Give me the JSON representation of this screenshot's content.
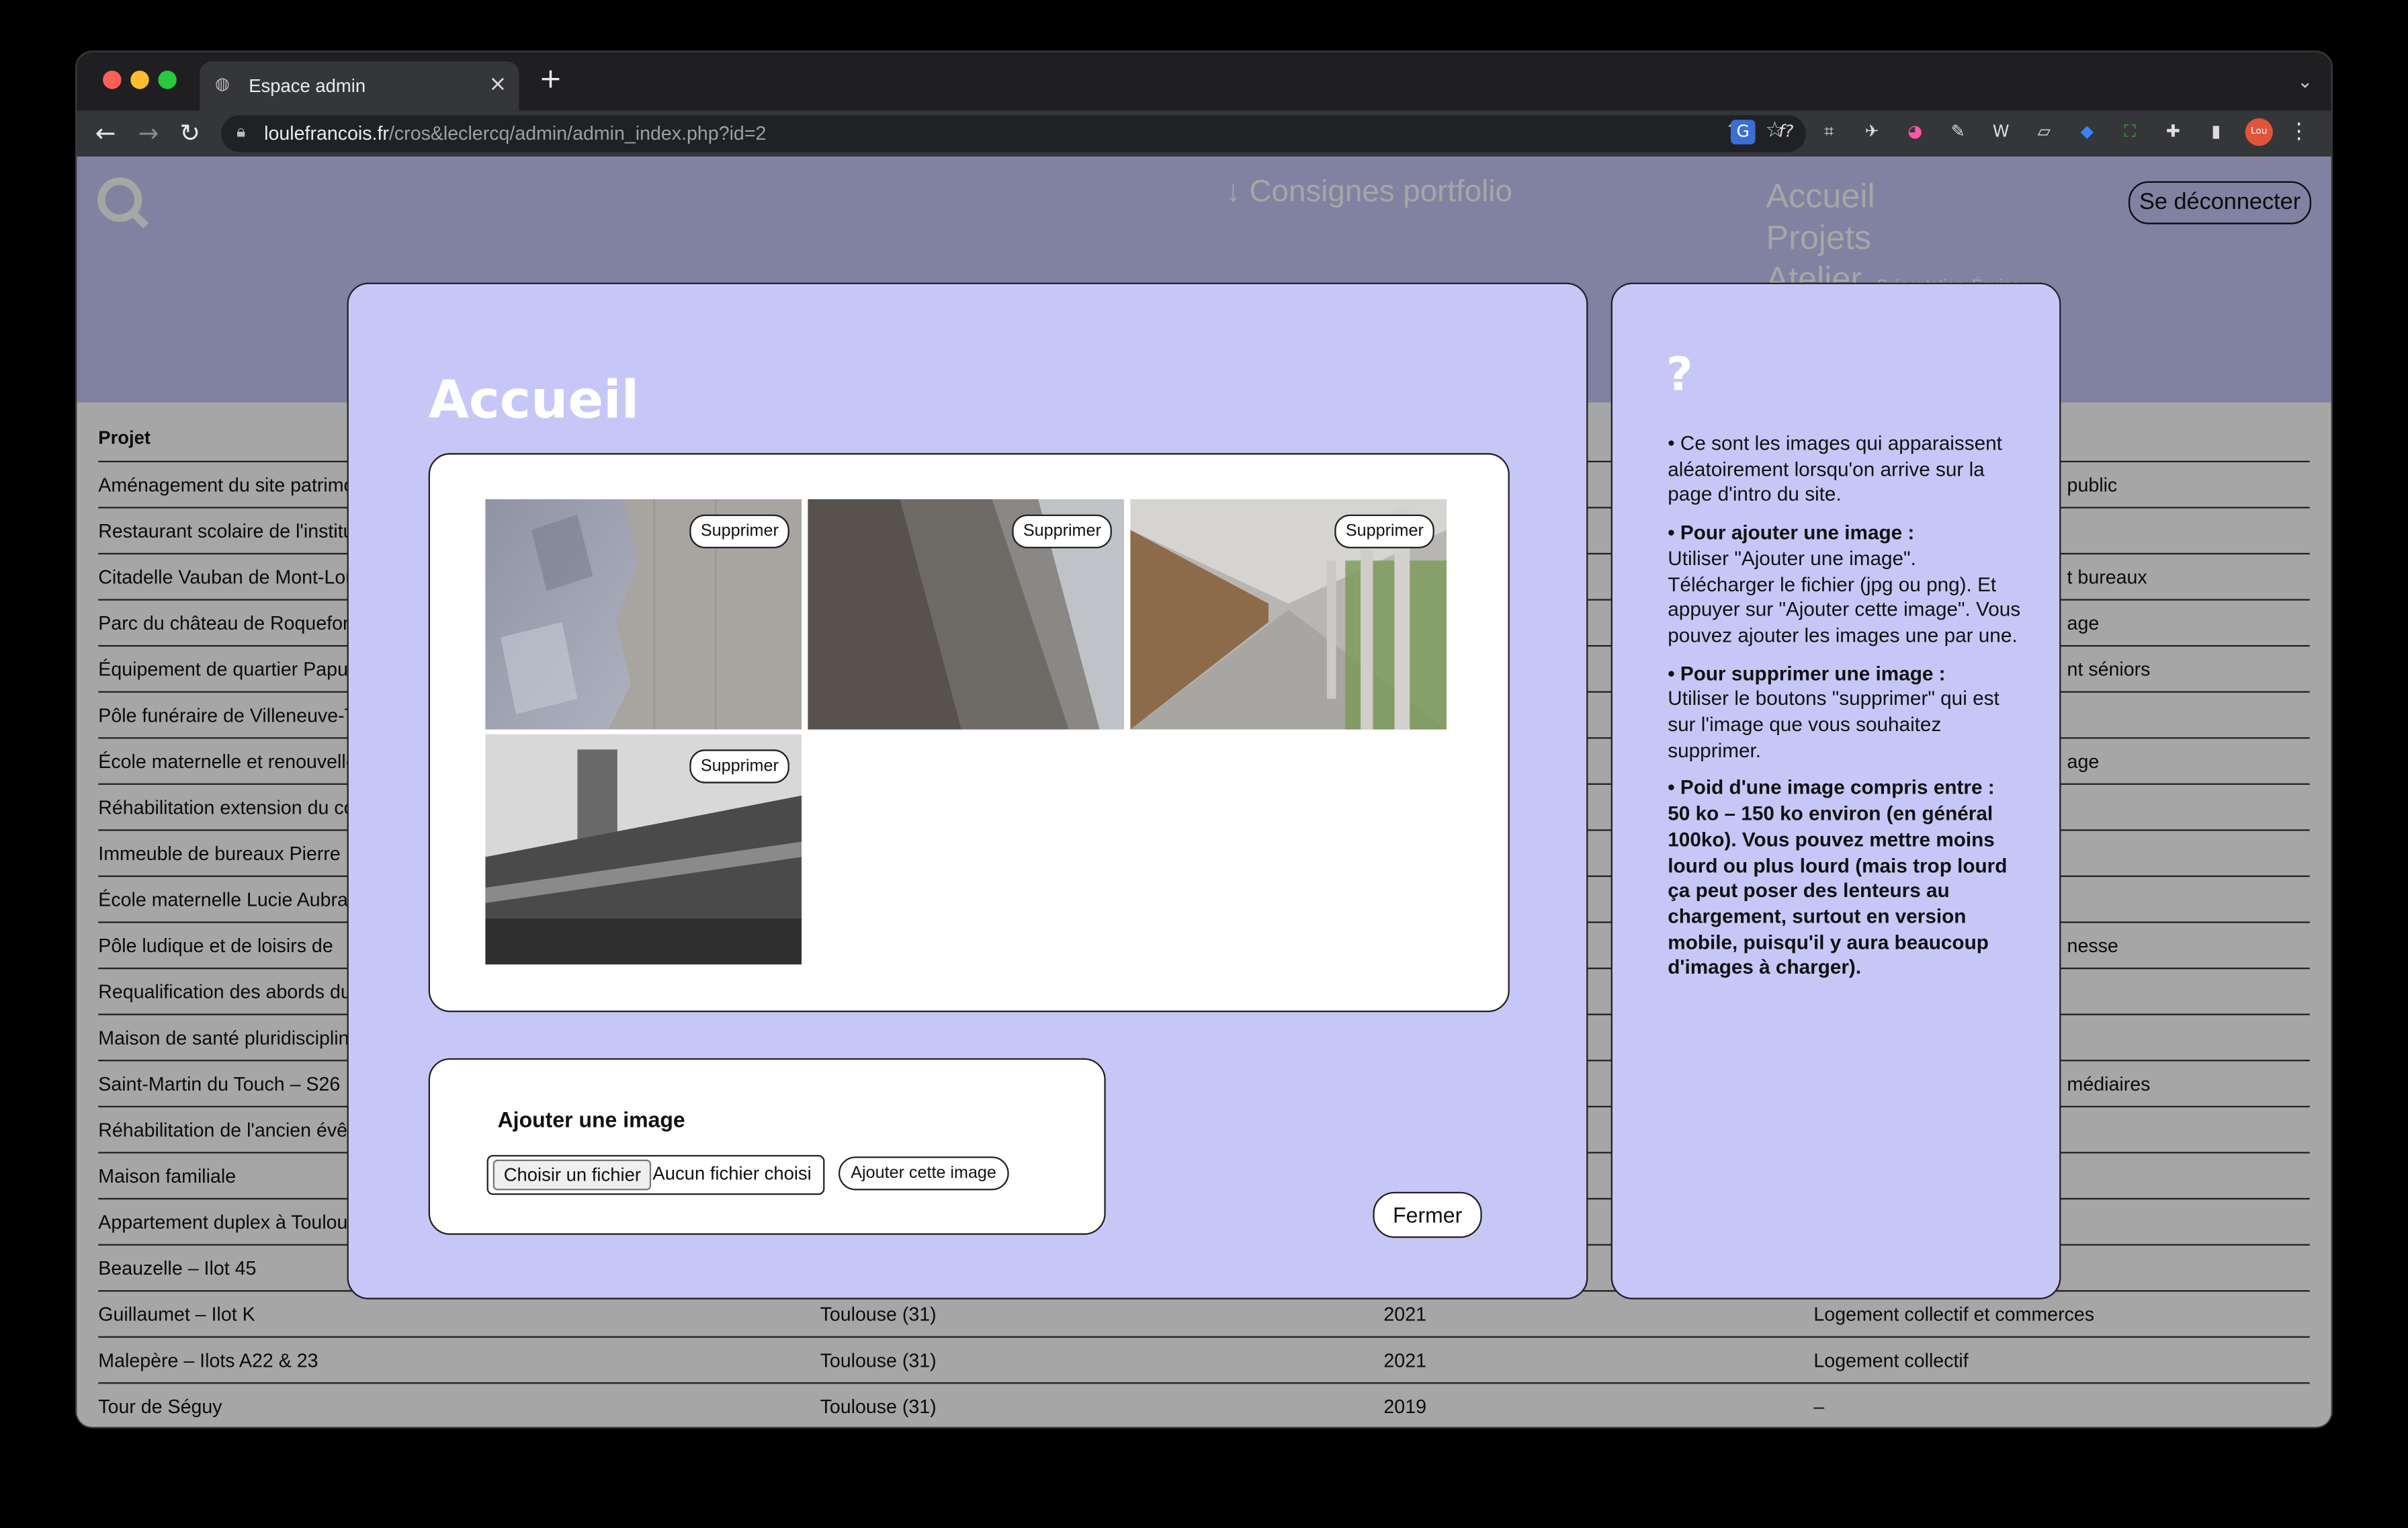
{
  "browser": {
    "tab_title": "Espace admin",
    "url_domain": "loulefrancois.fr",
    "url_path": "/cros&leclercq/admin/admin_index.php?id=2",
    "new_tab_symbol": "+",
    "tab_close_symbol": "×",
    "avatar_text": "Lou"
  },
  "site": {
    "consignes_label": "↓ Consignes portfolio",
    "menu": [
      "Accueil",
      "Projets",
      "Atelier"
    ],
    "menu_small": "Présentation, Équipe...",
    "logout_label": "Se déconnecter"
  },
  "table": {
    "header_project": "Projet",
    "rows": [
      {
        "project": "Aménagement du site patrimonial",
        "tail": "public"
      },
      {
        "project": "Restaurant scolaire de l'institut",
        "tail": ""
      },
      {
        "project": "Citadelle Vauban de Mont-Louis",
        "tail": "t bureaux"
      },
      {
        "project": "Parc du château de Roquefort",
        "tail": "age"
      },
      {
        "project": "Équipement de quartier Papus",
        "tail": "nt séniors"
      },
      {
        "project": "Pôle funéraire de Villeneuve-Tolosane",
        "tail": ""
      },
      {
        "project": "École maternelle et renouvellement",
        "tail": "age"
      },
      {
        "project": "Réhabilitation extension du collège",
        "tail": ""
      },
      {
        "project": "Immeuble de bureaux Pierre",
        "tail": ""
      },
      {
        "project": "École maternelle Lucie Aubrac",
        "tail": ""
      },
      {
        "project": "Pôle ludique et de loisirs de",
        "tail": "nesse"
      },
      {
        "project": "Requalification des abords du",
        "tail": ""
      },
      {
        "project": "Maison de santé pluridisciplinaire",
        "tail": ""
      },
      {
        "project": "Saint-Martin du Touch – S26",
        "tail": "médiaires"
      },
      {
        "project": "Réhabilitation de l'ancien évêché",
        "tail": ""
      },
      {
        "project": "Maison familiale",
        "tail": ""
      },
      {
        "project": "Appartement duplex à Toulouse",
        "tail": ""
      },
      {
        "project": "Beauzelle – Ilot 45",
        "tail": ""
      }
    ],
    "full_rows": [
      {
        "project": "Guillaumet – Ilot K",
        "city": "Toulouse (31)",
        "year": "2021",
        "type": "Logement collectif et commerces"
      },
      {
        "project": "Malepère – Ilots A22 & 23",
        "city": "Toulouse (31)",
        "year": "2021",
        "type": "Logement collectif"
      },
      {
        "project": "Tour de Séguy",
        "city": "Toulouse (31)",
        "year": "2019",
        "type": "–"
      }
    ]
  },
  "modal": {
    "title": "Accueil",
    "delete_label": "Supprimer",
    "images": [
      {
        "name": "concrete-rock-photo"
      },
      {
        "name": "stone-wall-photo"
      },
      {
        "name": "colonnade-photo"
      },
      {
        "name": "brick-building-tower-photo"
      }
    ],
    "add_title": "Ajouter une image",
    "file_button": "Choisir un fichier",
    "file_status": "Aucun fichier choisi",
    "submit_label": "Ajouter cette image",
    "close_label": "Fermer"
  },
  "help": {
    "title": "?",
    "p1": "• Ce sont les images qui apparaissent aléatoirement lorsqu'on arrive sur la page d'intro du site.",
    "p2_title": "• Pour ajouter une image :",
    "p2": "Utiliser \"Ajouter une image\". Télécharger le fichier (jpg ou png). Et appuyer sur \"Ajouter cette image\". Vous pouvez ajouter les images une par une.",
    "p3_title": "• Pour supprimer une image :",
    "p3": "Utiliser le boutons \"supprimer\" qui est sur l'image que vous souhaitez supprimer.",
    "p4": "• Poid d'une image compris entre : 50 ko – 150 ko environ (en général 100ko). Vous pouvez mettre moins lourd ou plus lourd (mais trop lourd ça peut poser des lenteurs au chargement, surtout en version mobile, puisqu'il y aura beaucoup d'images à charger)."
  },
  "colors": {
    "lavender": "#c7c7f7",
    "browser_dark": "#1f1f22",
    "toolbar": "#35363a"
  }
}
